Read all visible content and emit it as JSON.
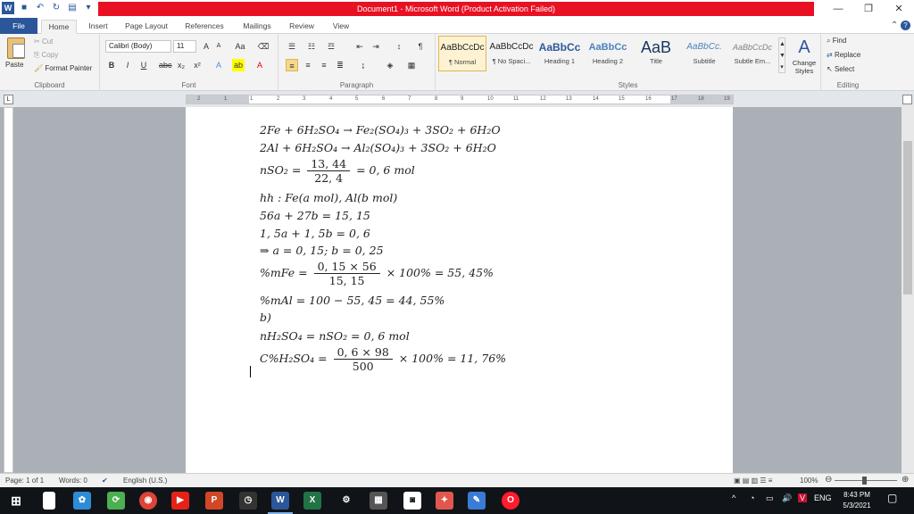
{
  "window": {
    "title": "Document1  -  Microsoft Word (Product Activation Failed)",
    "word_logo": "W"
  },
  "tabs": [
    "File",
    "Home",
    "Insert",
    "Page Layout",
    "References",
    "Mailings",
    "Review",
    "View"
  ],
  "active_tab": "Home",
  "ribbon": {
    "clipboard": {
      "label": "Clipboard",
      "paste": "Paste",
      "cut": "Cut",
      "copy": "Copy",
      "format_painter": "Format Painter"
    },
    "font": {
      "label": "Font",
      "family": "Calibri (Body)",
      "size": "11"
    },
    "paragraph": {
      "label": "Paragraph"
    },
    "styles": {
      "label": "Styles",
      "change_styles": "Change Styles",
      "items": [
        {
          "preview": "AaBbCcDc",
          "name": "¶ Normal"
        },
        {
          "preview": "AaBbCcDc",
          "name": "¶ No Spaci..."
        },
        {
          "preview": "AaBbCc",
          "name": "Heading 1"
        },
        {
          "preview": "AaBbCc",
          "name": "Heading 2"
        },
        {
          "preview": "AaB",
          "name": "Title"
        },
        {
          "preview": "AaBbCc.",
          "name": "Subtitle"
        },
        {
          "preview": "AaBbCcDc",
          "name": "Subtle Em..."
        }
      ]
    },
    "editing": {
      "label": "Editing",
      "find": "Find",
      "replace": "Replace",
      "select": "Select"
    }
  },
  "ruler": {
    "ticks": [
      "2",
      "1",
      "1",
      "2",
      "3",
      "4",
      "5",
      "6",
      "7",
      "8",
      "9",
      "10",
      "11",
      "12",
      "13",
      "14",
      "15",
      "16",
      "17",
      "18",
      "19"
    ]
  },
  "document": {
    "lines": {
      "l1": "2Fe + 6H₂SO₄ → Fe₂(SO₄)₃ + 3SO₂ + 6H₂O",
      "l2": "2Al + 6H₂SO₄ → Al₂(SO₄)₃ + 3SO₂ + 6H₂O",
      "l3_left": "nSO₂ =",
      "l3_num": "13, 44",
      "l3_den": "22, 4",
      "l3_right": "= 0, 6 mol",
      "l4": "hh : Fe(a mol), Al(b mol)",
      "l5": "56a + 27b = 15, 15",
      "l6": "1, 5a + 1, 5b = 0, 6",
      "l7": "⇒ a = 0, 15; b = 0, 25",
      "l8_left": "%mFe =",
      "l8_num": "0, 15 × 56",
      "l8_den": "15, 15",
      "l8_right": "× 100% = 55, 45%",
      "l9": "%mAl = 100 − 55, 45 = 44, 55%",
      "l10": "b)",
      "l11": "nH₂SO₄ = nSO₂ = 0, 6 mol",
      "l12_left": "C%H₂SO₄ =",
      "l12_num": "0, 6 × 98",
      "l12_den": "500",
      "l12_right": "× 100% = 11, 76%"
    }
  },
  "status": {
    "page": "Page: 1 of 1",
    "words": "Words: 0",
    "language": "English (U.S.)",
    "zoom": "100%"
  },
  "taskbar": {
    "language": "ENG",
    "time": "8:43 PM",
    "date": "5/3/2021"
  }
}
